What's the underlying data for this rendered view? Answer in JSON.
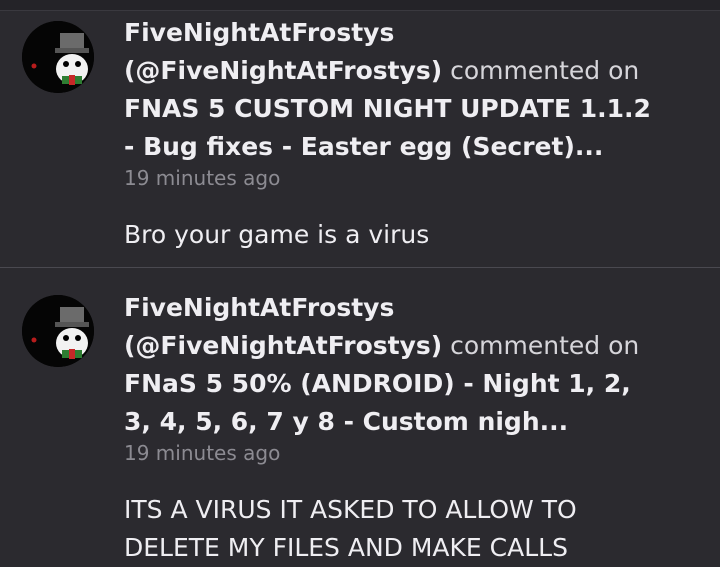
{
  "notifications": [
    {
      "author_name": "FiveNightAtFrostys",
      "author_handle": "(@FiveNightAtFrostys)",
      "action": "commented on",
      "title_line1": "FNAS 5 CUSTOM NIGHT UPDATE 1.1.2",
      "title_line2": "- Bug fixes - Easter egg (Secret)...",
      "time": "19 minutes ago",
      "comment_line1": "Bro your game is a virus",
      "comment_line2": ""
    },
    {
      "author_name": "FiveNightAtFrostys",
      "author_handle": "(@FiveNightAtFrostys)",
      "action": "commented on",
      "title_line1": "FNaS 5 50% (ANDROID)  - Night 1, 2,",
      "title_line2": "3, 4, 5, 6, 7 y 8 - Custom nigh...",
      "time": "19 minutes ago",
      "comment_line1": "ITS A VIRUS IT ASKED TO ALLOW TO",
      "comment_line2": "DELETE MY FILES AND MAKE CALLS"
    }
  ],
  "colors": {
    "background": "#2b2a2f",
    "text": "#efeef2",
    "muted": "#8c8b92",
    "divider": "#4a4950"
  }
}
